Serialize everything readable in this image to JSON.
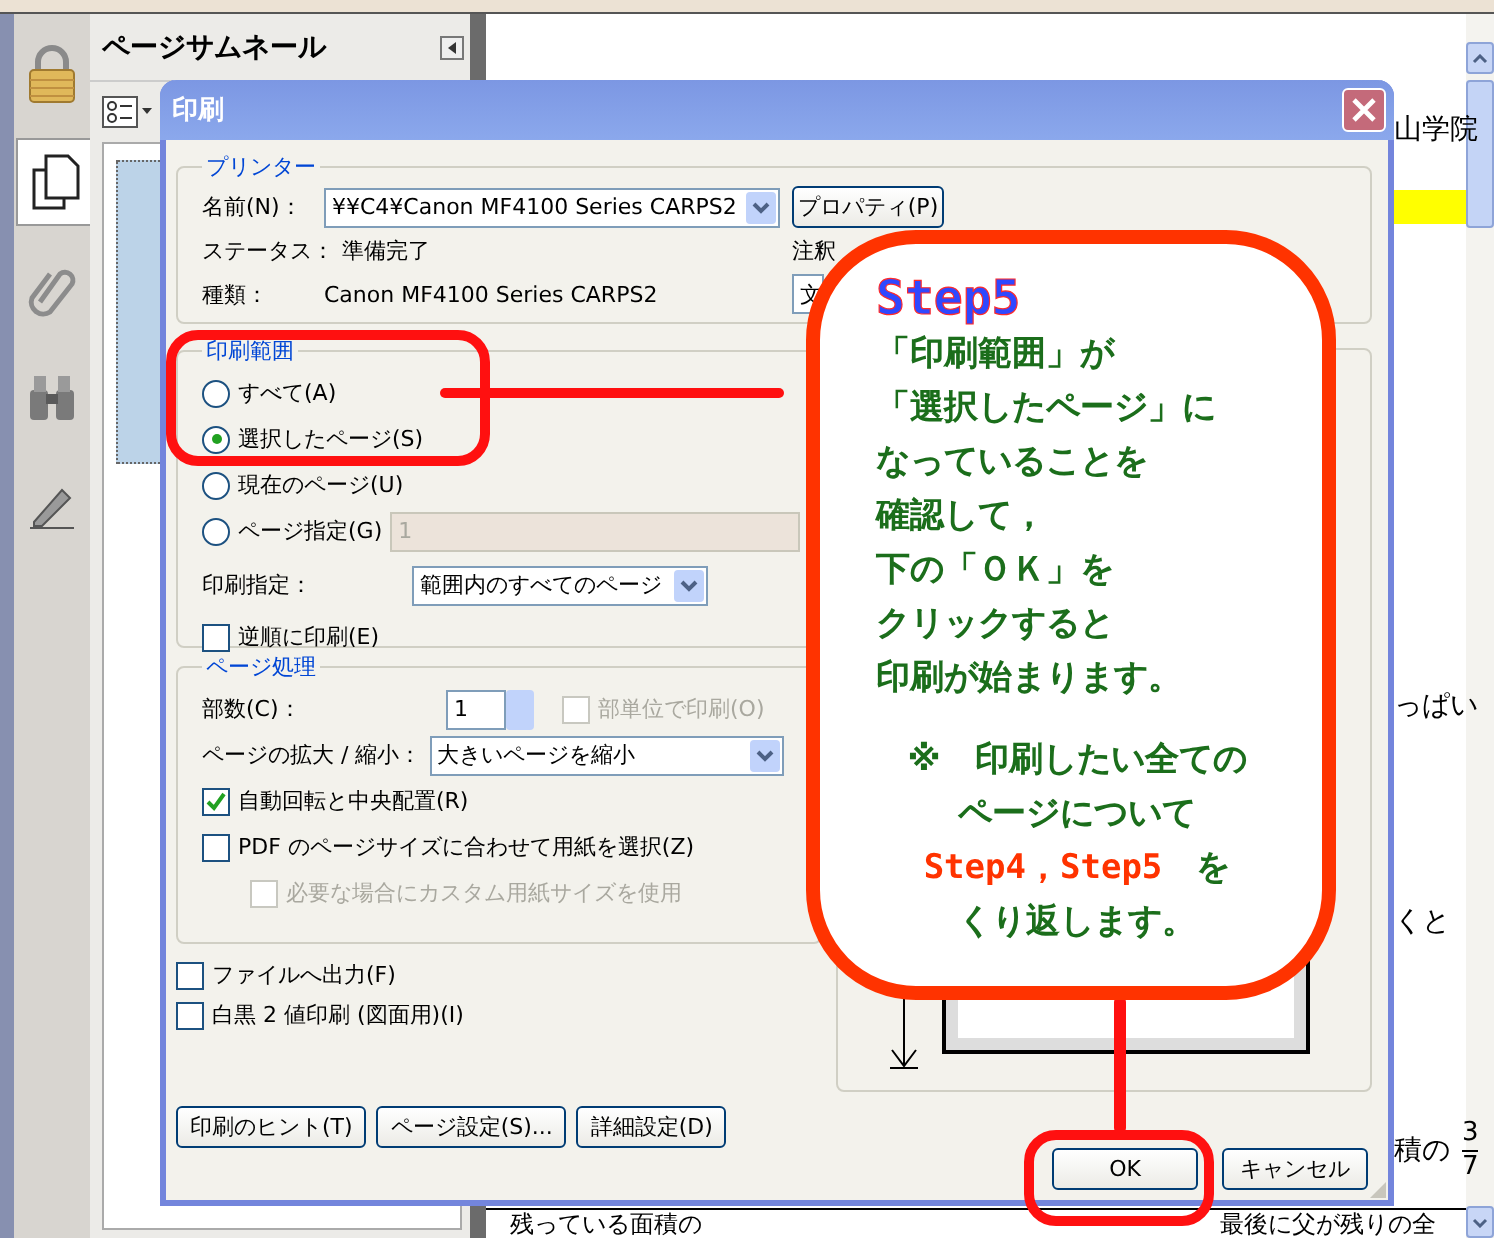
{
  "tools": [
    {
      "kind": "lock",
      "selected": false
    },
    {
      "kind": "pages",
      "selected": true
    },
    {
      "kind": "clip",
      "selected": false
    },
    {
      "kind": "binoculars",
      "selected": false
    },
    {
      "kind": "pen",
      "selected": false
    }
  ],
  "thumbnail_panel": {
    "title": "ページサムネール"
  },
  "document": {
    "heading_fragment": "山学院",
    "line_fragments": [
      "っぱい",
      "くと"
    ],
    "fraction_line": {
      "text": "積の",
      "numerator": "3",
      "denominator": "7"
    },
    "table_cells": [
      "残っている面積の",
      "最後に父が残りの全"
    ]
  },
  "dialog": {
    "title": "印刷",
    "printer": {
      "legend": "プリンター",
      "name_label": "名前(N)：",
      "name_value": "¥¥C4¥Canon MF4100 Series CARPS2",
      "properties_button": "プロパティ(P)",
      "status_label": "ステータス：",
      "status_value": "準備完了",
      "type_label": "種類：",
      "type_value": "Canon MF4100 Series CARPS2",
      "comments_label": "注釈",
      "comments_value": "文"
    },
    "range": {
      "legend": "印刷範囲",
      "options": [
        {
          "label": "すべて(A)",
          "selected": false
        },
        {
          "label": "選択したページ(S)",
          "selected": true
        },
        {
          "label": "現在のページ(U)",
          "selected": false
        },
        {
          "label": "ページ指定(G)",
          "selected": false
        }
      ],
      "pages_field": {
        "value": "1",
        "disabled": true
      },
      "subset_label": "印刷指定：",
      "subset_value": "範囲内のすべてのページ",
      "reverse": {
        "label": "逆順に印刷(E)",
        "checked": false
      }
    },
    "handling": {
      "legend": "ページ処理",
      "copies_label": "部数(C)：",
      "copies_value": "1",
      "collate": {
        "label": "部単位で印刷(O)",
        "checked": false,
        "disabled": true
      },
      "scaling_label": "ページの拡大 / 縮小：",
      "scaling_value": "大きいページを縮小",
      "options": [
        {
          "label": "自動回転と中央配置(R)",
          "checked": true,
          "disabled": false
        },
        {
          "label": "PDF のページサイズに合わせて用紙を選択(Z)",
          "checked": false,
          "disabled": false,
          "children": [
            {
              "label": "必要な場合にカスタム用紙サイズを使用",
              "checked": false,
              "disabled": true
            }
          ]
        }
      ]
    },
    "extra_options": [
      {
        "label": "ファイルへ出力(F)",
        "checked": false
      },
      {
        "label": "白黒 2 値印刷 (図面用)(I)",
        "checked": false
      }
    ],
    "left_buttons": [
      "印刷のヒント(T)",
      "ページ設定(S)...",
      "詳細設定(D)"
    ],
    "ok_button": "OK",
    "cancel_button": "キャンセル"
  },
  "callout": {
    "title": "Step5",
    "lines": [
      "「印刷範囲」が",
      "「選択したページ」に",
      "なっていることを",
      "確認して，",
      "下の「ＯＫ」を",
      "クリックすると",
      "印刷が始まります。"
    ],
    "note_lines": [
      {
        "segments": [
          {
            "text": "※　印刷したい全ての",
            "kind": "plain"
          }
        ]
      },
      {
        "segments": [
          {
            "text": "ページについて",
            "kind": "plain"
          }
        ]
      },
      {
        "segments": [
          {
            "text": "Step4，Step5",
            "kind": "highlight"
          },
          {
            "text": "　を",
            "kind": "plain"
          }
        ]
      },
      {
        "segments": [
          {
            "text": "くり返します。",
            "kind": "plain"
          }
        ]
      }
    ]
  }
}
